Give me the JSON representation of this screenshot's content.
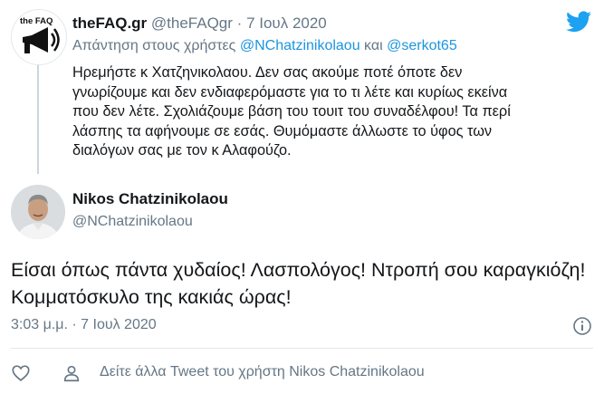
{
  "parent_tweet": {
    "author_name": "theFAQ.gr",
    "author_handle": "@theFAQgr",
    "dot": "·",
    "date": "7 Ιουλ 2020",
    "avatar_label": "the FAQ",
    "reply_prefix": "Απάντηση στους χρήστες",
    "mention_1": "@NChatzinikolaou",
    "reply_joiner": "και",
    "mention_2": "@serkot65",
    "text": "Ηρεμήστε κ Χατζηνικολαου. Δεν σας ακούμε ποτέ όποτε δεν γνωρίζουμε και δεν ενδιαφερόμαστε για το τι λέτε και κυρίως εκείνα που δεν λέτε. Σχολιάζουμε βάση του τουιτ του συναδέλφου! Τα περί λάσπης τα αφήνουμε σε εσάς. Θυμόμαστε άλλωστε το ύφος των διαλόγων σας με τον κ Αλαφούζο."
  },
  "main_tweet": {
    "author_name": "Nikos Chatzinikolaou",
    "author_handle": "@NChatzinikolaou",
    "text": "Είσαι όπως πάντα χυδαίος! Λασπολόγος! Ντροπή σου καραγκιόζη! Κομματόσκυλο της κακιάς ώρας!",
    "time": "3:03 μ.μ.",
    "dot": "·",
    "date": "7 Ιουλ 2020"
  },
  "actions": {
    "more_tweets_link": "Δείτε άλλα Tweet του χρήστη Nikos Chatzinikolaou"
  },
  "colors": {
    "twitter_blue": "#1da1f2",
    "link_blue": "#1b95e0",
    "secondary_text": "#657786",
    "primary_text": "#14171a"
  },
  "icons": [
    "twitter-bird-icon",
    "info-icon",
    "heart-icon",
    "person-icon",
    "megaphone-icon"
  ]
}
